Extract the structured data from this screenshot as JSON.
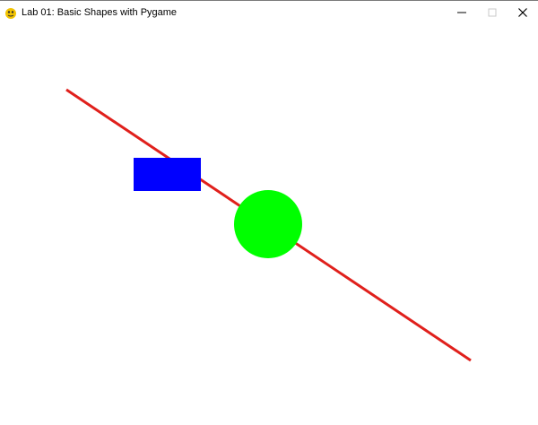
{
  "window": {
    "title": "Lab 01: Basic Shapes with Pygame"
  },
  "colors": {
    "background": "#ffffff",
    "line": "#e0201c",
    "rectangle": "#0000ff",
    "circle": "#00ff00"
  },
  "icons": {
    "app": "pygame-snake-icon",
    "minimize": "minimize-icon",
    "maximize": "maximize-icon",
    "close": "close-icon"
  }
}
